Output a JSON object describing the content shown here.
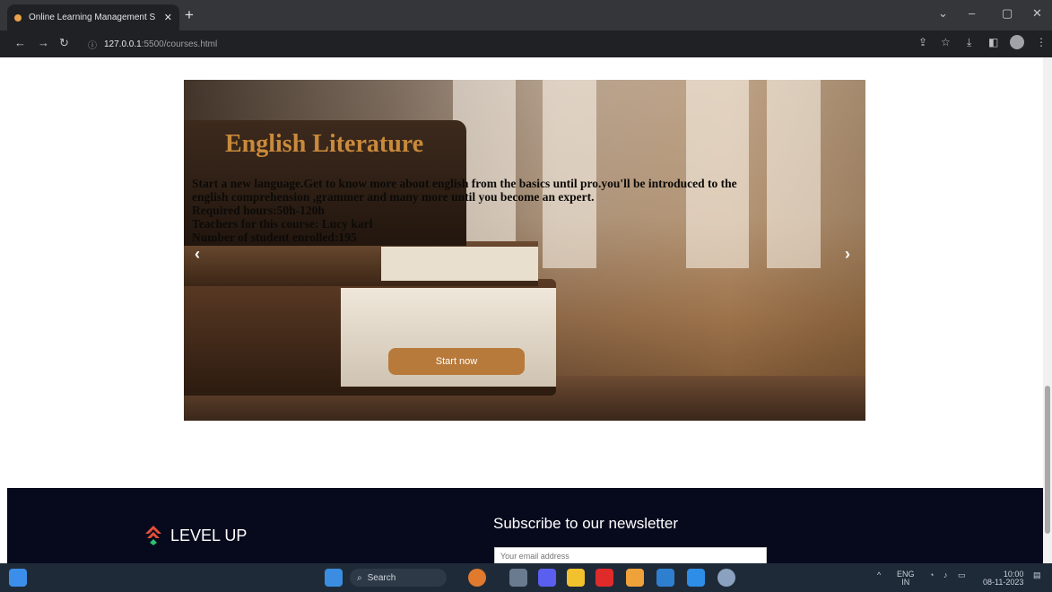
{
  "browser": {
    "tab_title": "Online Learning Management S",
    "url_host": "127.0.0.1",
    "url_path": ":5500/courses.html"
  },
  "slide": {
    "title": "English Literature",
    "description_lines": [
      "Start a new language.Get to know more about english from the basics until pro.you'll be introduced to the",
      "english comprehension ,grammer and many more  until you become an expert.",
      "Required hours:50h-120h",
      "Teachers for this course: Lucy karl",
      "Number of student enrolled:195"
    ],
    "button_label": "Start now",
    "prev_icon": "‹",
    "next_icon": "›"
  },
  "footer": {
    "brand": "LEVEL UP",
    "newsletter_title": "Subscribe to our newsletter",
    "email_placeholder": "Your email address"
  },
  "taskbar": {
    "search_label": "Search",
    "lang_top": "ENG",
    "lang_bottom": "IN",
    "time": "10:00",
    "date": "08-11-2023"
  },
  "colors": {
    "accent": "#b87a3a",
    "title": "#c98a3c",
    "footer_bg": "#060a1c"
  }
}
